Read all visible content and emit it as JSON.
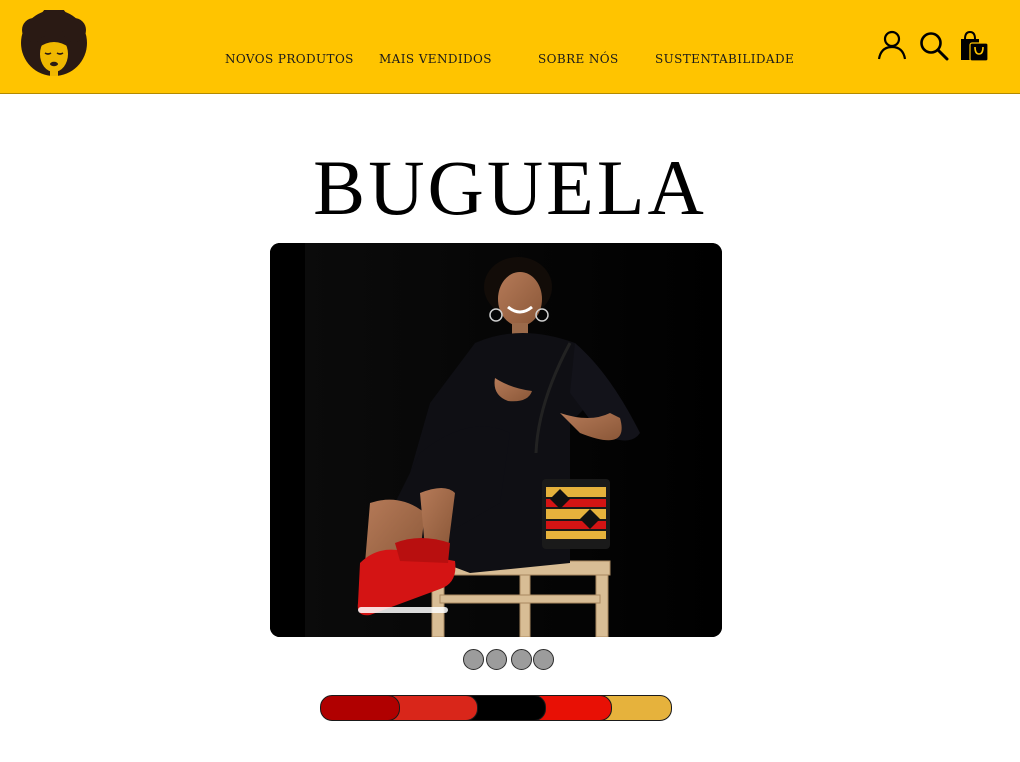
{
  "header": {
    "logo_icon": "afro-woman-logo-icon",
    "nav": [
      {
        "label": "NOVOS PRODUTOS"
      },
      {
        "label": "MAIS VENDIDOS"
      },
      {
        "label": "SOBRE NÓS"
      },
      {
        "label": "SUSTENTABILIDADE"
      }
    ],
    "icons": [
      "user-icon",
      "search-icon",
      "shopping-bag-icon"
    ]
  },
  "main": {
    "title": "BUGUELA",
    "carousel": {
      "slide_count": 4,
      "hero_image": "woman-in-black-dress-with-red-sneakers-photo"
    },
    "color_swatches": [
      {
        "name": "dark-red",
        "color": "#b00000"
      },
      {
        "name": "red-orange",
        "color": "#d9261a"
      },
      {
        "name": "black",
        "color": "#000000"
      },
      {
        "name": "bright-red",
        "color": "#e81005"
      },
      {
        "name": "mustard",
        "color": "#e6b23c"
      }
    ]
  },
  "colors": {
    "header_bg": "#ffc400",
    "text": "#000000",
    "dot": "#9c9c9c"
  }
}
